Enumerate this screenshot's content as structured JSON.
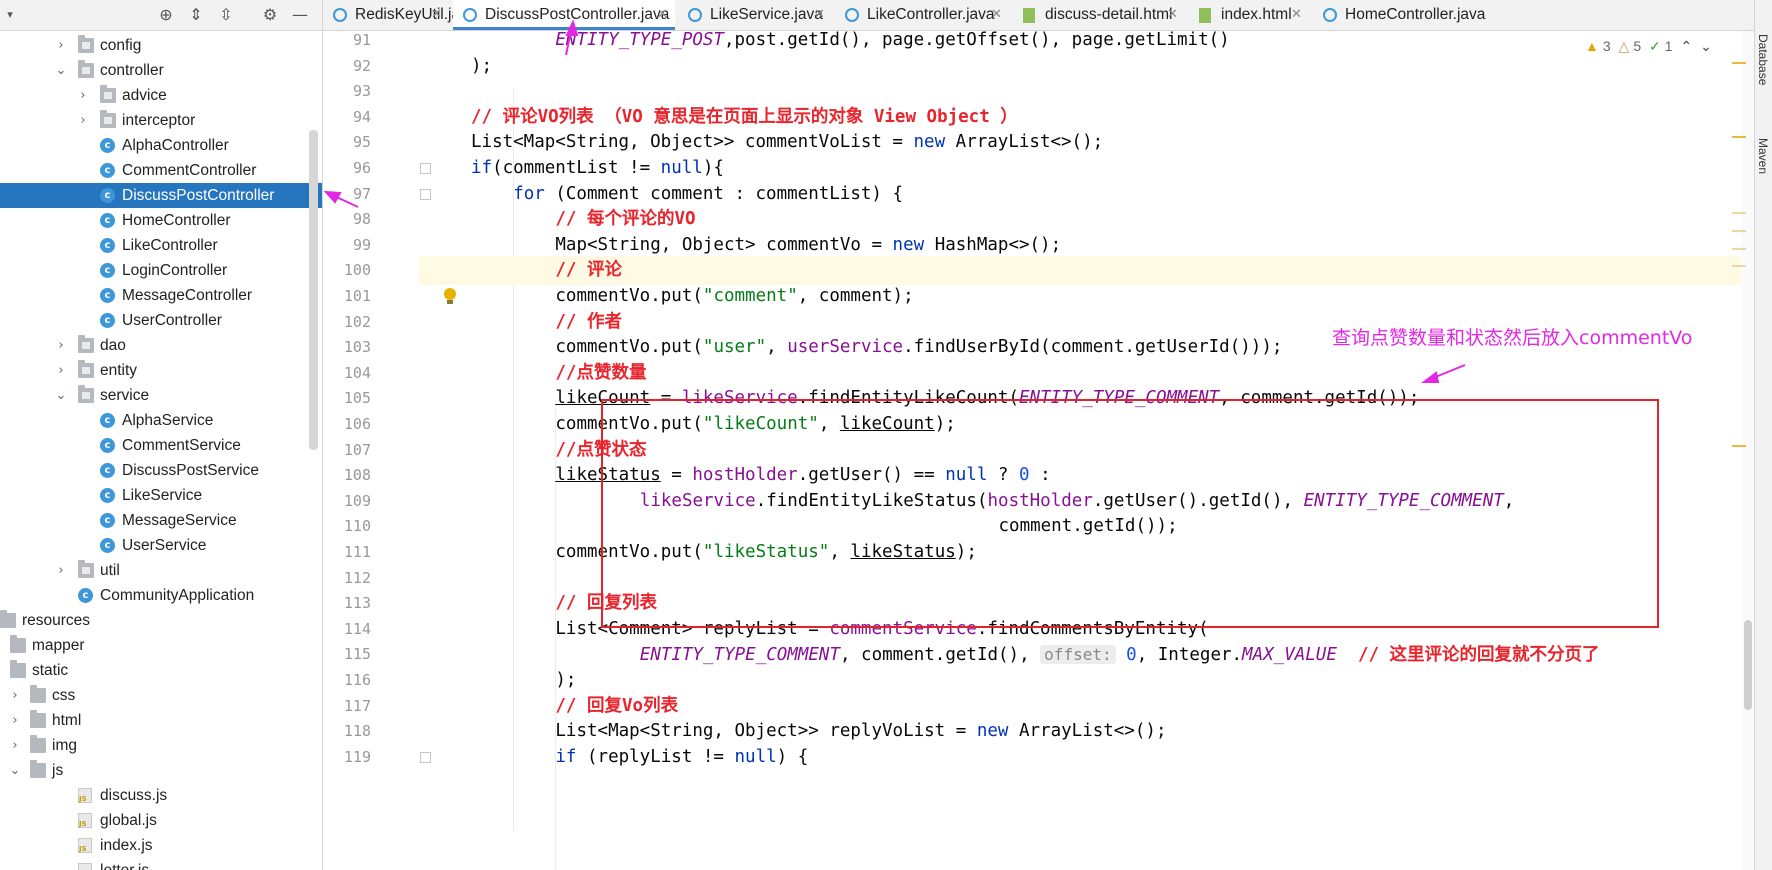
{
  "tree": {
    "items": [
      {
        "label": "config",
        "depth": 3,
        "kind": "pkg",
        "chev": "right"
      },
      {
        "label": "controller",
        "depth": 3,
        "kind": "pkg",
        "chev": "down"
      },
      {
        "label": "advice",
        "depth": 4,
        "kind": "pkg",
        "chev": "right"
      },
      {
        "label": "interceptor",
        "depth": 4,
        "kind": "pkg",
        "chev": "right"
      },
      {
        "label": "AlphaController",
        "depth": 4,
        "kind": "class"
      },
      {
        "label": "CommentController",
        "depth": 4,
        "kind": "class"
      },
      {
        "label": "DiscussPostController",
        "depth": 4,
        "kind": "class",
        "selected": true
      },
      {
        "label": "HomeController",
        "depth": 4,
        "kind": "class"
      },
      {
        "label": "LikeController",
        "depth": 4,
        "kind": "class"
      },
      {
        "label": "LoginController",
        "depth": 4,
        "kind": "class"
      },
      {
        "label": "MessageController",
        "depth": 4,
        "kind": "class"
      },
      {
        "label": "UserController",
        "depth": 4,
        "kind": "class"
      },
      {
        "label": "dao",
        "depth": 3,
        "kind": "pkg",
        "chev": "right"
      },
      {
        "label": "entity",
        "depth": 3,
        "kind": "pkg",
        "chev": "right"
      },
      {
        "label": "service",
        "depth": 3,
        "kind": "pkg",
        "chev": "down"
      },
      {
        "label": "AlphaService",
        "depth": 4,
        "kind": "class"
      },
      {
        "label": "CommentService",
        "depth": 4,
        "kind": "class"
      },
      {
        "label": "DiscussPostService",
        "depth": 4,
        "kind": "class"
      },
      {
        "label": "LikeService",
        "depth": 4,
        "kind": "class"
      },
      {
        "label": "MessageService",
        "depth": 4,
        "kind": "class"
      },
      {
        "label": "UserService",
        "depth": 4,
        "kind": "class"
      },
      {
        "label": "util",
        "depth": 3,
        "kind": "pkg",
        "chev": "right"
      },
      {
        "label": "CommunityApplication",
        "depth": 3,
        "kind": "app"
      },
      {
        "label": "resources",
        "depth": 0,
        "kind": "folder"
      },
      {
        "label": "mapper",
        "depth": 1,
        "kind": "folder"
      },
      {
        "label": "static",
        "depth": 1,
        "kind": "folder"
      },
      {
        "label": "css",
        "depth": 2,
        "kind": "folder",
        "chev": "right"
      },
      {
        "label": "html",
        "depth": 2,
        "kind": "folder",
        "chev": "right"
      },
      {
        "label": "img",
        "depth": 2,
        "kind": "folder",
        "chev": "right"
      },
      {
        "label": "js",
        "depth": 2,
        "kind": "folder",
        "chev": "down"
      },
      {
        "label": "discuss.js",
        "depth": 3,
        "kind": "js"
      },
      {
        "label": "global.js",
        "depth": 3,
        "kind": "js"
      },
      {
        "label": "index.js",
        "depth": 3,
        "kind": "js"
      },
      {
        "label": "letter.js",
        "depth": 3,
        "kind": "js"
      }
    ]
  },
  "tabs": [
    {
      "label": "RedisKeyUtil.java",
      "kind": "java"
    },
    {
      "label": "DiscussPostController.java",
      "kind": "java",
      "active": true
    },
    {
      "label": "LikeService.java",
      "kind": "java"
    },
    {
      "label": "LikeController.java",
      "kind": "java"
    },
    {
      "label": "discuss-detail.html",
      "kind": "html"
    },
    {
      "label": "index.html",
      "kind": "html"
    },
    {
      "label": "HomeController.java",
      "kind": "java"
    }
  ],
  "inspection": {
    "warnings": "3",
    "weak_warnings": "5",
    "typos": "1"
  },
  "right_tools": {
    "database": "Database",
    "maven": "Maven"
  },
  "annotation": {
    "note": "查询点赞数量和状态然后放入commentVo"
  },
  "editor": {
    "current_line": 100,
    "lines": [
      {
        "n": 91,
        "indent": 8,
        "parts": [
          [
            "cst",
            "ENTITY_TYPE_POST"
          ],
          [
            "",
            ","
          ],
          [
            "",
            "post.getId(), page.getOffset(), page.getLimit()"
          ]
        ]
      },
      {
        "n": 92,
        "indent": 0,
        "parts": [
          [
            "",
            ");"
          ]
        ]
      },
      {
        "n": 93,
        "indent": 0,
        "parts": []
      },
      {
        "n": 94,
        "indent": 0,
        "parts": [
          [
            "cm",
            "// 评论VO列表 （VO 意思是在页面上显示的对象 View Object ）"
          ]
        ]
      },
      {
        "n": 95,
        "indent": 0,
        "parts": [
          [
            "",
            "List<Map<String, Object>> commentVoList = "
          ],
          [
            "kw",
            "new"
          ],
          [
            "",
            " ArrayList<>();"
          ]
        ]
      },
      {
        "n": 96,
        "indent": 0,
        "parts": [
          [
            "kw",
            "if"
          ],
          [
            "",
            "(commentList != "
          ],
          [
            "kw",
            "null"
          ],
          [
            "",
            "){"
          ]
        ]
      },
      {
        "n": 97,
        "indent": 4,
        "parts": [
          [
            "kw",
            "for"
          ],
          [
            "",
            " (Comment comment : commentList) {"
          ]
        ]
      },
      {
        "n": 98,
        "indent": 8,
        "parts": [
          [
            "cm",
            "// 每个评论的VO"
          ]
        ]
      },
      {
        "n": 99,
        "indent": 8,
        "parts": [
          [
            "",
            "Map<String, Object> commentVo = "
          ],
          [
            "kw",
            "new"
          ],
          [
            "",
            " HashMap<>();"
          ]
        ]
      },
      {
        "n": 100,
        "indent": 8,
        "parts": [
          [
            "cm",
            "// 评论"
          ]
        ]
      },
      {
        "n": 101,
        "indent": 8,
        "parts": [
          [
            "",
            "commentVo.put("
          ],
          [
            "str",
            "\"comment\""
          ],
          [
            "",
            ", comment);"
          ]
        ]
      },
      {
        "n": 102,
        "indent": 8,
        "parts": [
          [
            "cm",
            "// 作者"
          ]
        ]
      },
      {
        "n": 103,
        "indent": 8,
        "parts": [
          [
            "",
            "commentVo.put("
          ],
          [
            "str",
            "\"user\""
          ],
          [
            "",
            ", "
          ],
          [
            "fld",
            "userService"
          ],
          [
            "",
            ".findUserById(comment.getUserId()));"
          ]
        ]
      },
      {
        "n": 104,
        "indent": 8,
        "parts": [
          [
            "cm",
            "//点赞数量"
          ]
        ]
      },
      {
        "n": 105,
        "indent": 8,
        "parts": [
          [
            "ul",
            "likeCount"
          ],
          [
            "",
            " = "
          ],
          [
            "fld",
            "likeService"
          ],
          [
            "",
            ".findEntityLikeCount("
          ],
          [
            "cst",
            "ENTITY_TYPE_COMMENT"
          ],
          [
            "",
            ", comment.getId());"
          ]
        ]
      },
      {
        "n": 106,
        "indent": 8,
        "parts": [
          [
            "",
            "commentVo.put("
          ],
          [
            "str",
            "\"likeCount\""
          ],
          [
            "",
            ", "
          ],
          [
            "ul",
            "likeCount"
          ],
          [
            "",
            ");"
          ]
        ]
      },
      {
        "n": 107,
        "indent": 8,
        "parts": [
          [
            "cm",
            "//点赞状态"
          ]
        ]
      },
      {
        "n": 108,
        "indent": 8,
        "parts": [
          [
            "ul",
            "likeStatus"
          ],
          [
            "",
            " = "
          ],
          [
            "fld",
            "hostHolder"
          ],
          [
            "",
            ".getUser() == "
          ],
          [
            "kw",
            "null"
          ],
          [
            "",
            " ? "
          ],
          [
            "num",
            "0"
          ],
          [
            "",
            " :"
          ]
        ]
      },
      {
        "n": 109,
        "indent": 16,
        "parts": [
          [
            "fld",
            "likeService"
          ],
          [
            "",
            ".findEntityLikeStatus("
          ],
          [
            "fld",
            "hostHolder"
          ],
          [
            "",
            ".getUser().getId(), "
          ],
          [
            "cst",
            "ENTITY_TYPE_COMMENT"
          ],
          [
            "",
            ","
          ]
        ]
      },
      {
        "n": 110,
        "indent": 50,
        "parts": [
          [
            "",
            "comment.getId());"
          ]
        ]
      },
      {
        "n": 111,
        "indent": 8,
        "parts": [
          [
            "",
            "commentVo.put("
          ],
          [
            "str",
            "\"likeStatus\""
          ],
          [
            "",
            ", "
          ],
          [
            "ul",
            "likeStatus"
          ],
          [
            "",
            ");"
          ]
        ]
      },
      {
        "n": 112,
        "indent": 0,
        "parts": []
      },
      {
        "n": 113,
        "indent": 8,
        "parts": [
          [
            "cm",
            "// 回复列表"
          ]
        ]
      },
      {
        "n": 114,
        "indent": 8,
        "parts": [
          [
            "",
            "List<Comment> replyList = "
          ],
          [
            "fld",
            "commentService"
          ],
          [
            "",
            ".findCommentsByEntity("
          ]
        ]
      },
      {
        "n": 115,
        "indent": 16,
        "parts": [
          [
            "cst",
            "ENTITY_TYPE_COMMENT"
          ],
          [
            "",
            ", comment.getId(), "
          ],
          [
            "hint",
            "offset:"
          ],
          [
            "num",
            " 0"
          ],
          [
            "",
            ", Integer."
          ],
          [
            "cst",
            "MAX_VALUE"
          ],
          [
            "",
            "  "
          ],
          [
            "cm",
            "// 这里评论的回复就不分页了"
          ]
        ]
      },
      {
        "n": 116,
        "indent": 8,
        "parts": [
          [
            "",
            ");"
          ]
        ]
      },
      {
        "n": 117,
        "indent": 8,
        "parts": [
          [
            "cm",
            "// 回复Vo列表"
          ]
        ]
      },
      {
        "n": 118,
        "indent": 8,
        "parts": [
          [
            "",
            "List<Map<String, Object>> replyVoList = "
          ],
          [
            "kw",
            "new"
          ],
          [
            "",
            " ArrayList<>();"
          ]
        ]
      },
      {
        "n": 119,
        "indent": 8,
        "parts": [
          [
            "kw",
            "if"
          ],
          [
            "",
            " (replyList != "
          ],
          [
            "kw",
            "null"
          ],
          [
            "",
            ") {"
          ]
        ]
      }
    ]
  },
  "colors": {
    "accent": "#2675bf",
    "annotation": "#e328e3",
    "box": "#e0242c"
  }
}
